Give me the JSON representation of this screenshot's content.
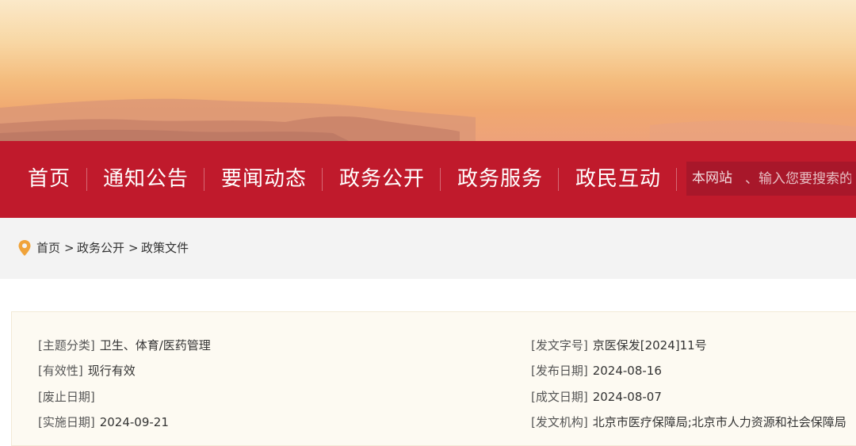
{
  "nav": {
    "items": [
      {
        "label": "首页"
      },
      {
        "label": "通知公告"
      },
      {
        "label": "要闻动态"
      },
      {
        "label": "政务公开"
      },
      {
        "label": "政务服务"
      },
      {
        "label": "政民互动"
      }
    ],
    "search_scope": "本网站",
    "search_placeholder": "、输入您要搜索的"
  },
  "breadcrumb": {
    "items": [
      "首页",
      "政务公开",
      "政策文件"
    ],
    "separator": ">"
  },
  "info": {
    "left": [
      {
        "key": "[主题分类]",
        "value": "卫生、体育/医药管理"
      },
      {
        "key": "[有效性]",
        "value": "现行有效"
      },
      {
        "key": "[废止日期]",
        "value": ""
      },
      {
        "key": "[实施日期]",
        "value": "2024-09-21"
      }
    ],
    "right": [
      {
        "key": "[发文字号]",
        "value": "京医保发[2024]11号"
      },
      {
        "key": "[发布日期]",
        "value": "2024-08-16"
      },
      {
        "key": "[成文日期]",
        "value": "2024-08-07"
      },
      {
        "key": "[发文机构]",
        "value": "北京市医疗保障局;北京市人力资源和社会保障局"
      }
    ]
  },
  "colors": {
    "nav_bg": "#c01a2c",
    "crumb_bg": "#f3f3f3",
    "panel_bg": "#fdfaf2",
    "pin": "#f0a33a"
  }
}
